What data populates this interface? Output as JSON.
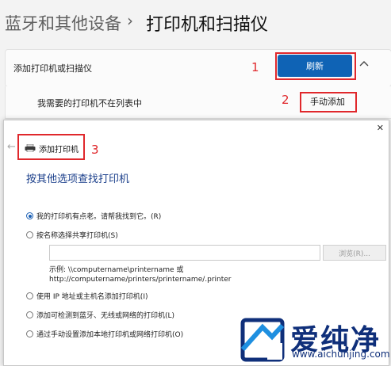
{
  "header": {
    "breadcrumb_parent": "蓝牙和其他设备",
    "separator": "›",
    "current": "打印机和扫描仪"
  },
  "add_card": {
    "title": "添加打印机或扫描仪",
    "refresh_label": "刷新",
    "step1": "1",
    "collapse_icon": "chevron-up-icon"
  },
  "not_listed": {
    "label": "我需要的打印机不在列表中",
    "manual_add_label": "手动添加",
    "step2": "2"
  },
  "dialog": {
    "close": "✕",
    "back": "←",
    "title": "添加打印机",
    "step3": "3",
    "heading": "按其他选项查找打印机",
    "options": [
      {
        "label": "我的打印机有点老。请帮我找到它。(R)",
        "selected": true
      },
      {
        "label": "按名称选择共享打印机(S)",
        "selected": false
      },
      {
        "label": "使用 IP 地址或主机名添加打印机(I)",
        "selected": false
      },
      {
        "label": "添加可检测到蓝牙、无线或网络的打印机(L)",
        "selected": false
      },
      {
        "label": "通过手动设置添加本地打印机或网络打印机(O)",
        "selected": false
      }
    ],
    "share_input_value": "",
    "browse_label": "浏览(R)...",
    "example_line1": "示例: \\\\computername\\printername 或",
    "example_line2": "http://computername/printers/printername/.printer"
  },
  "watermark": {
    "name": "爱纯净",
    "url": "www.aichunjing.com"
  },
  "colors": {
    "accent": "#0f63b5",
    "annotation": "#e0282c",
    "heading": "#1b3f8b",
    "watermark": "#0f2f7a"
  }
}
